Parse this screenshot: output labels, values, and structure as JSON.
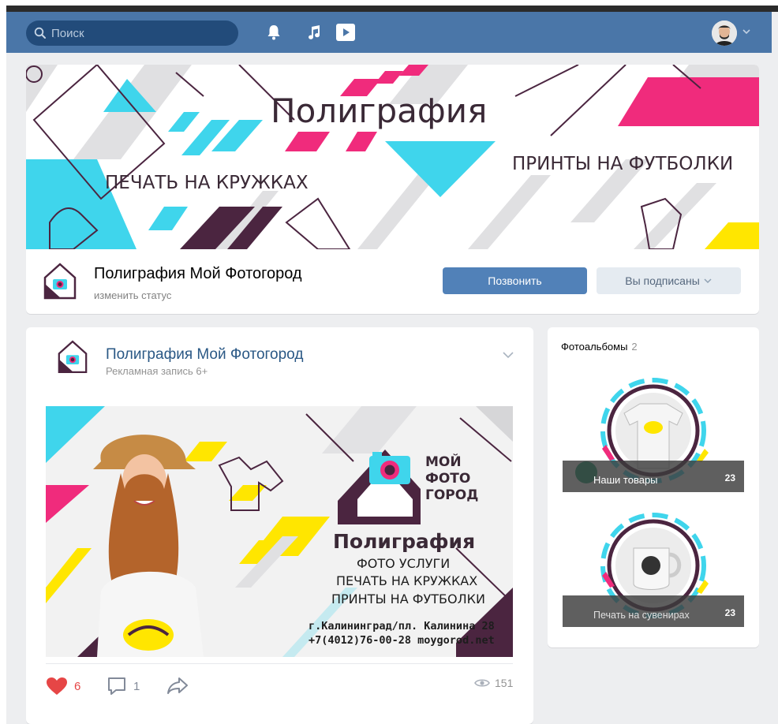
{
  "header": {
    "search_placeholder": "Поиск",
    "icons": [
      "search-icon",
      "bell-icon",
      "music-icon",
      "video-icon",
      "avatar",
      "chevron-down-icon"
    ]
  },
  "cover": {
    "title": "Полиграфия",
    "left_caption": "ПЕЧАТЬ НА КРУЖКАХ",
    "right_caption": "ПРИНТЫ НА ФУТБОЛКИ"
  },
  "group": {
    "name": "Полиграфия Мой Фотогород",
    "status": "изменить статус",
    "call_button": "Позвонить",
    "subscribed_button": "Вы подписаны"
  },
  "post": {
    "author": "Полиграфия Мой Фотогород",
    "subtitle": "Рекламная запись 6+",
    "ad": {
      "brand": [
        "МОЙ",
        "ФОТО",
        "ГОРОД"
      ],
      "headline": "Полиграфия",
      "line1": "ФОТО УСЛУГИ",
      "line2": "ПЕЧАТЬ НА КРУЖКАХ",
      "line3": "ПРИНТЫ НА ФУТБОЛКИ",
      "address": "г.Калининград/пл. Калинина 28",
      "phone": "+7(4012)76-00-28  moygorod.net"
    },
    "likes": "6",
    "comments": "1",
    "views": "151"
  },
  "albums": {
    "title": "Фотоальбомы",
    "count": "2",
    "items": [
      {
        "name": "Наши товары",
        "count": "23"
      },
      {
        "name": "Печать на сувенирах",
        "count": "23"
      }
    ]
  },
  "colors": {
    "header": "#4a76a8",
    "accent_button": "#5181b8",
    "cyan": "#3fd5ec",
    "magenta": "#f02b7c",
    "plum": "#4b2540",
    "yellow": "#ffe600",
    "like": "#e64646"
  }
}
